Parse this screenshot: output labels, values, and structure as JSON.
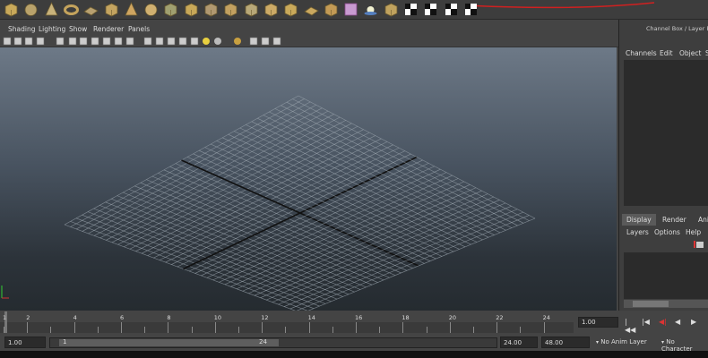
{
  "panel_menu": [
    "Shading",
    "Lighting",
    "Show",
    "Renderer",
    "Panels"
  ],
  "channel_box": {
    "title": "Channel Box / Layer Edito",
    "menu": [
      "Channels",
      "Edit",
      "Object",
      "S"
    ]
  },
  "layer_editor": {
    "tabs": [
      "Display",
      "Render",
      "Ani"
    ],
    "active_tab": "Display",
    "menu": [
      "Layers",
      "Options",
      "Help"
    ]
  },
  "time_slider": {
    "ticks": [
      "1",
      "2",
      "4",
      "6",
      "8",
      "10",
      "12",
      "14",
      "16",
      "18",
      "20",
      "22",
      "24"
    ],
    "current_frame": "1.00"
  },
  "range_slider": {
    "start_time": "1.00",
    "range_start_label": "1",
    "range_end_label": "24",
    "end_time": "24.00",
    "max_time": "48.00",
    "anim_layer": "No Anim Layer",
    "character_set": "No Character"
  },
  "icons": {
    "shelf": [
      "cube-icon",
      "sphere-icon",
      "cone-icon",
      "torus-icon",
      "plane-icon",
      "cylinder-icon",
      "pyramid-icon",
      "sphere-icon",
      "helix-icon",
      "cube-icon",
      "pipe-icon",
      "cube-icon",
      "soccer-ball-icon",
      "cube-icon",
      "move-icon",
      "plane-icon",
      "cube-icon",
      "shader-icon",
      "light-icon",
      "cube-icon",
      "checker-icon",
      "checker-icon",
      "checker-icon",
      "checker-icon"
    ],
    "playback": [
      "go-start-icon",
      "step-back-key-icon",
      "step-back-icon",
      "play-back-icon",
      "play-forward-icon"
    ]
  },
  "colors": {
    "accent_red": "#d02020",
    "viewport_top": "#6d7987",
    "viewport_bottom": "#252b30",
    "grid": "#9aa4ad"
  }
}
